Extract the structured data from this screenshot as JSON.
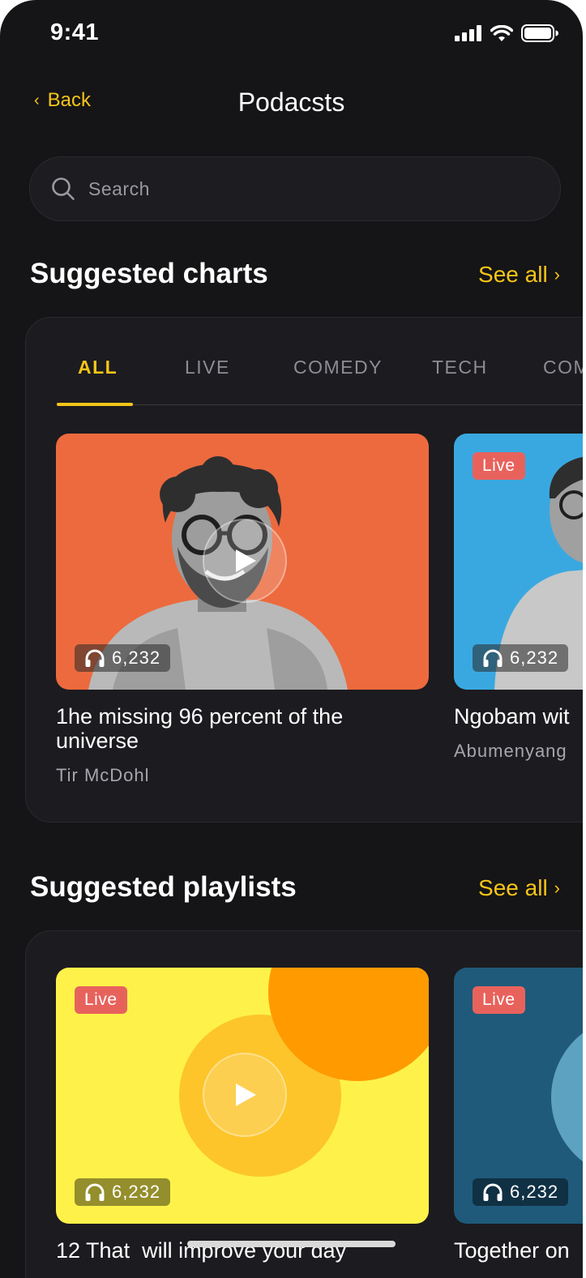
{
  "status": {
    "time": "9:41"
  },
  "nav": {
    "back_label": "Back",
    "title": "Podacsts"
  },
  "search": {
    "placeholder": "Search"
  },
  "charts": {
    "title": "Suggested charts",
    "see_all": "See all",
    "tabs": [
      "ALL",
      "LIVE",
      "COMEDY",
      "TECH",
      "COM"
    ],
    "active_tab": "ALL",
    "cards": [
      {
        "title": "1he missing 96 percent of the universe",
        "author": "Tir McDohl",
        "listens": "6,232",
        "live": false
      },
      {
        "title": "Ngobam wit",
        "author": "Abumenyang",
        "listens": "6,232",
        "live": true,
        "live_label": "Live"
      }
    ]
  },
  "playlists": {
    "title": "Suggested playlists",
    "see_all": "See all",
    "cards": [
      {
        "title": "12 That  will improve your day",
        "listens": "6,232",
        "live_label": "Live"
      },
      {
        "title": "Together on",
        "listens": "6,232",
        "live_label": "Live"
      }
    ]
  },
  "colors": {
    "accent": "#f5c518",
    "background": "#151416",
    "live_badge": "#e8625c",
    "card1_bg": "#ec6a3e",
    "card2_bg": "#3aa8e0",
    "playlist1_bg": "#fef24a",
    "playlist2_bg": "#1f5a7a"
  },
  "icons": [
    "signal-icon",
    "wifi-icon",
    "battery-icon",
    "chevron-left-icon",
    "search-icon",
    "chevron-right-icon",
    "play-icon",
    "headphones-icon"
  ]
}
